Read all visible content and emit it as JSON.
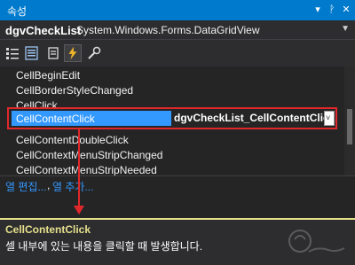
{
  "window": {
    "title": "속성"
  },
  "object": {
    "name": "dgvCheckList",
    "type": "System.Windows.Forms.DataGridView"
  },
  "toolbar": {
    "icons": [
      "categorized-icon",
      "alphabetical-icon",
      "properties-icon",
      "events-icon",
      "property-pages-icon"
    ],
    "active": "events-icon"
  },
  "events": [
    {
      "label": "CellBeginEdit"
    },
    {
      "label": "CellBorderStyleChanged"
    },
    {
      "label": "CellClick"
    },
    {
      "label": "CellContentClick",
      "value": "dgvCheckList_CellContentClick",
      "selected": true
    },
    {
      "label": "CellContentDoubleClick"
    },
    {
      "label": "CellContextMenuStripChanged"
    },
    {
      "label": "CellContextMenuStripNeeded"
    }
  ],
  "links": {
    "edit_columns": "열 편집...",
    "separator": ",",
    "add_column": "열 추가..."
  },
  "description": {
    "title": "CellContentClick",
    "text": "셀 내부에 있는 내용을 클릭할 때 발생합니다."
  },
  "colors": {
    "accent": "#007acc",
    "selection": "#3399ff",
    "highlight_box": "#e0282b",
    "description_title": "#e6e08c"
  }
}
